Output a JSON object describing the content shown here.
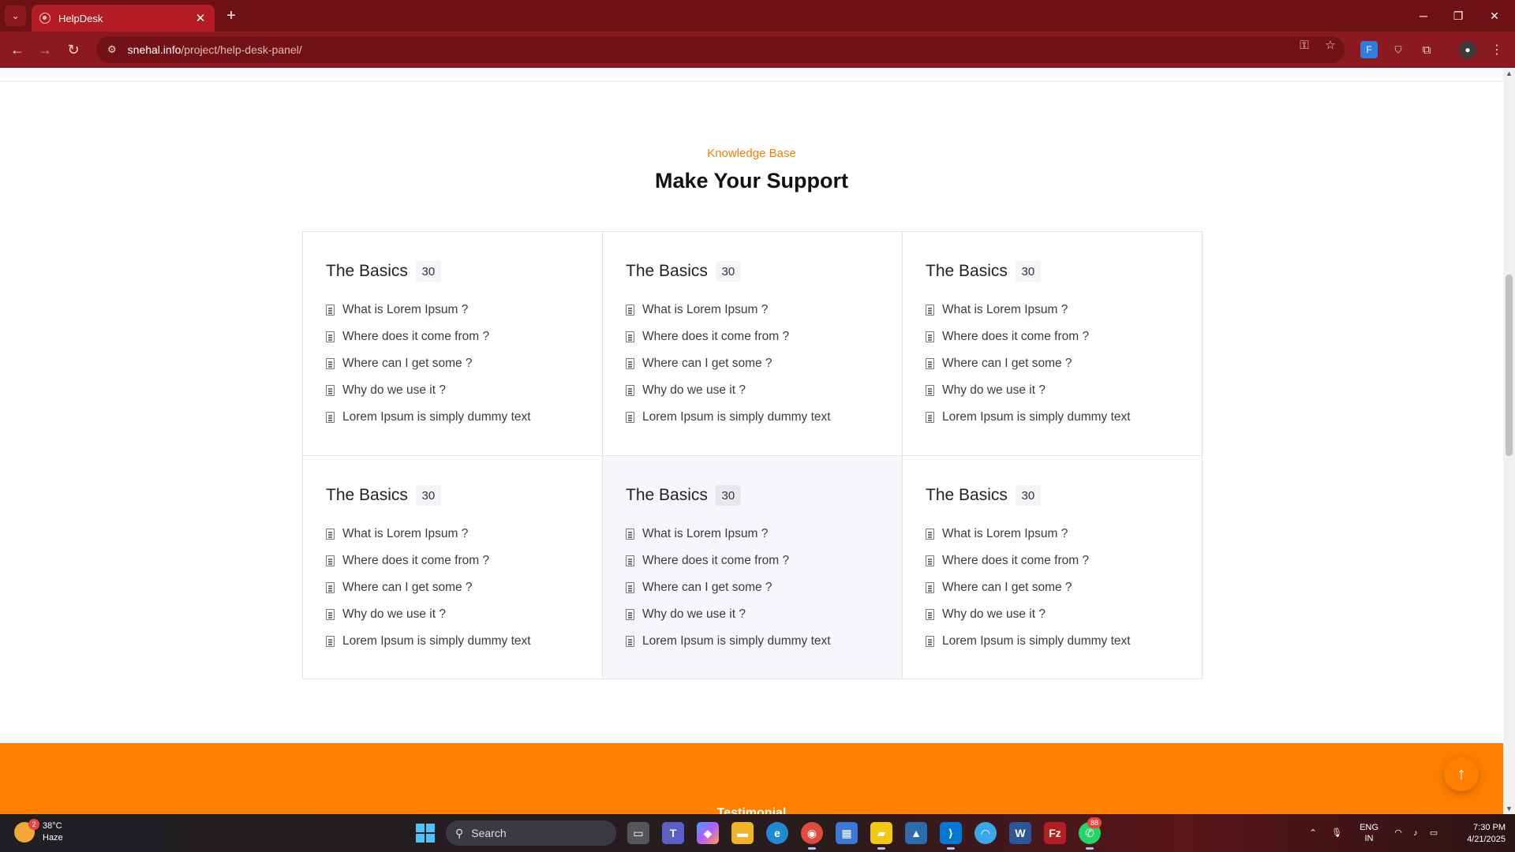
{
  "browser": {
    "tab_title": "HelpDesk",
    "tab_close": "✕",
    "new_tab": "+",
    "url_host": "snehal.info",
    "url_path": "/project/help-desk-panel/"
  },
  "page": {
    "eyebrow": "Knowledge Base",
    "heading": "Make Your Support",
    "categories": [
      {
        "title": "The Basics",
        "count": "30",
        "articles": [
          "What is Lorem Ipsum ?",
          "Where does it come from ?",
          "Where can I get some ?",
          "Why do we use it ?",
          "Lorem Ipsum is simply dummy text"
        ]
      },
      {
        "title": "The Basics",
        "count": "30",
        "articles": [
          "What is Lorem Ipsum ?",
          "Where does it come from ?",
          "Where can I get some ?",
          "Why do we use it ?",
          "Lorem Ipsum is simply dummy text"
        ]
      },
      {
        "title": "The Basics",
        "count": "30",
        "articles": [
          "What is Lorem Ipsum ?",
          "Where does it come from ?",
          "Where can I get some ?",
          "Why do we use it ?",
          "Lorem Ipsum is simply dummy text"
        ]
      },
      {
        "title": "The Basics",
        "count": "30",
        "articles": [
          "What is Lorem Ipsum ?",
          "Where does it come from ?",
          "Where can I get some ?",
          "Why do we use it ?",
          "Lorem Ipsum is simply dummy text"
        ]
      },
      {
        "title": "The Basics",
        "count": "30",
        "articles": [
          "What is Lorem Ipsum ?",
          "Where does it come from ?",
          "Where can I get some ?",
          "Why do we use it ?",
          "Lorem Ipsum is simply dummy text"
        ]
      },
      {
        "title": "The Basics",
        "count": "30",
        "articles": [
          "What is Lorem Ipsum ?",
          "Where does it come from ?",
          "Where can I get some ?",
          "Why do we use it ?",
          "Lorem Ipsum is simply dummy text"
        ]
      }
    ],
    "band_title": "Testimonial",
    "colors": {
      "accent": "#ff8000",
      "eyebrow": "#f77f00",
      "browser_frame": "#8a1a1f"
    }
  },
  "taskbar": {
    "weather_badge": "2",
    "temperature": "38°C",
    "condition": "Haze",
    "search_label": "Search",
    "notification_badge": "88",
    "language_line1": "ENG",
    "language_line2": "IN",
    "time": "7:30 PM",
    "date": "4/21/2025"
  }
}
